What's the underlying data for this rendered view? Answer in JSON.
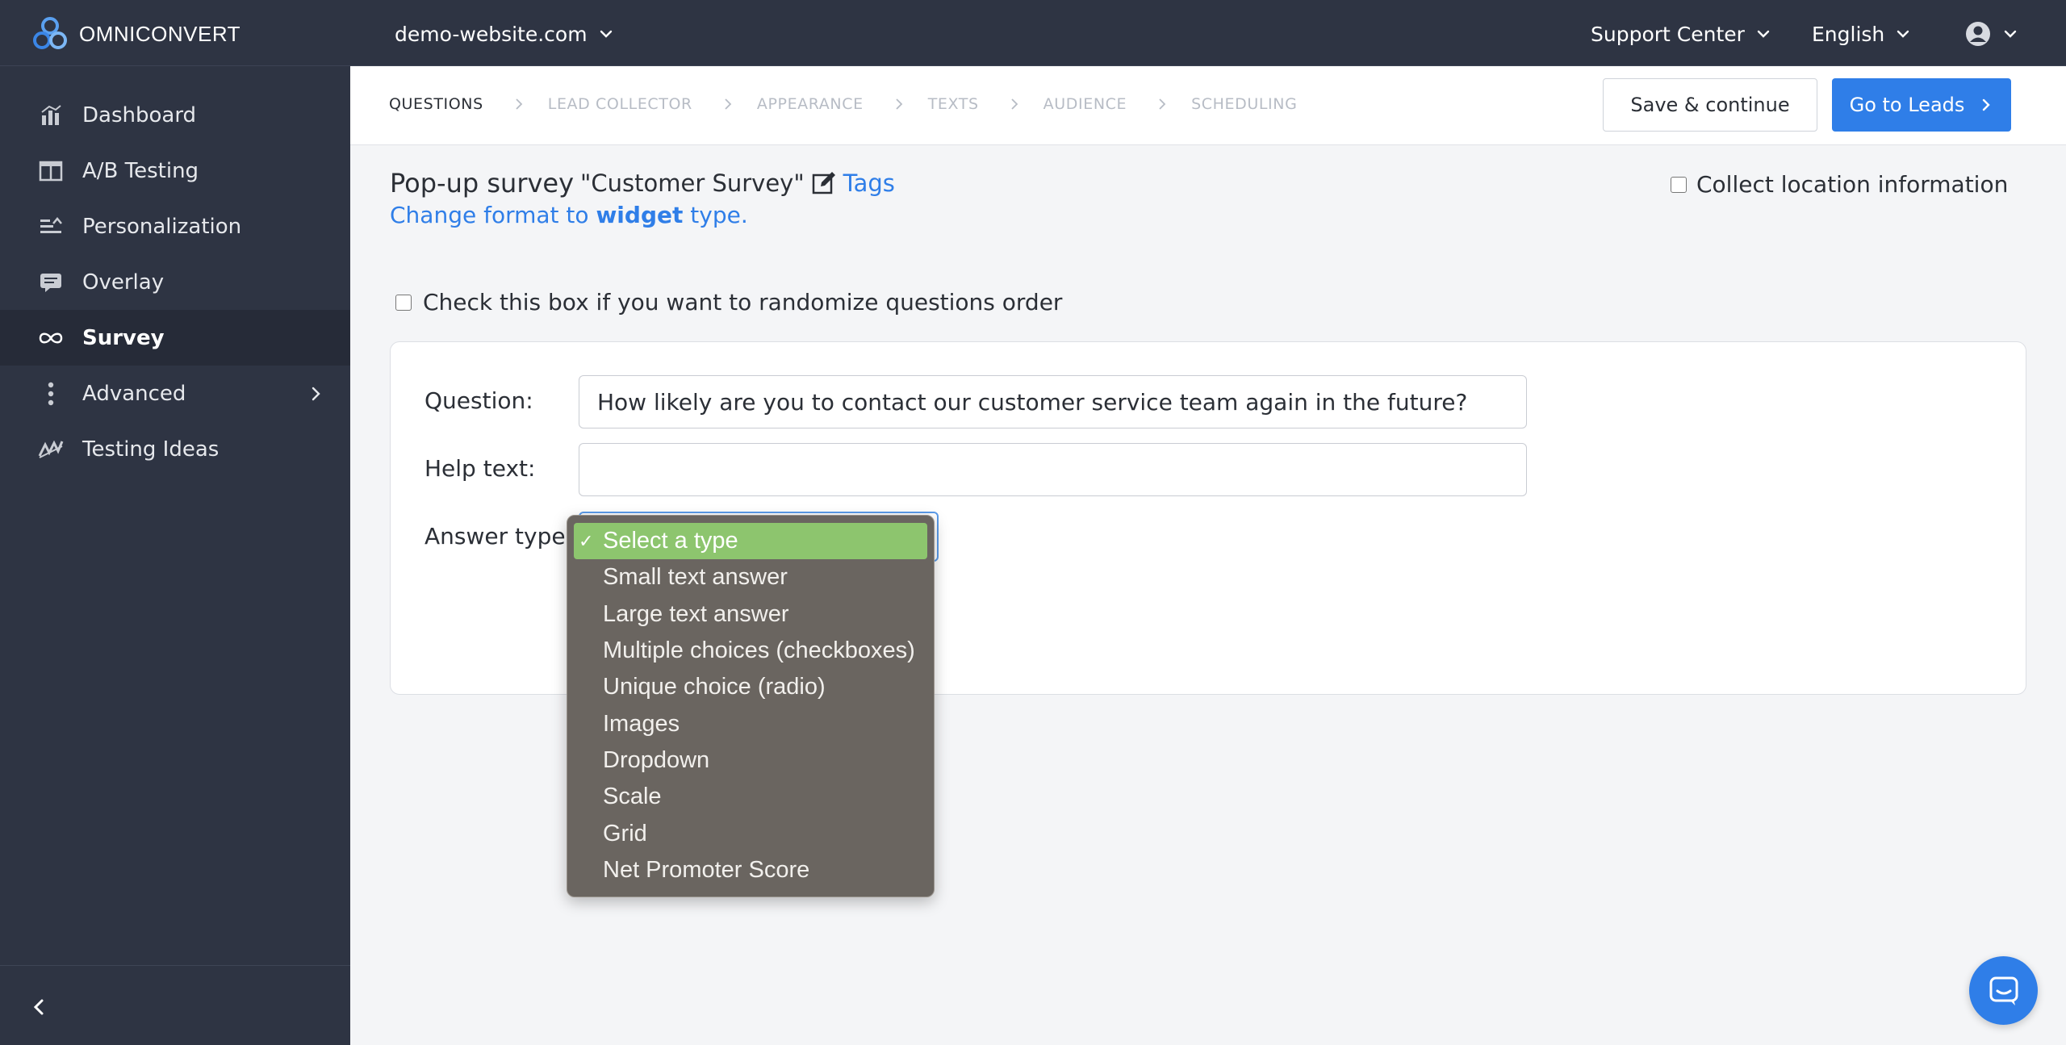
{
  "brand": {
    "name": "OMNICONVERT"
  },
  "topbar": {
    "website": "demo-website.com",
    "support": "Support Center",
    "language": "English"
  },
  "sidebar": {
    "items": [
      {
        "label": "Dashboard",
        "icon": "bar-chart-icon"
      },
      {
        "label": "A/B Testing",
        "icon": "split-window-icon"
      },
      {
        "label": "Personalization",
        "icon": "personalization-icon"
      },
      {
        "label": "Overlay",
        "icon": "overlay-icon"
      },
      {
        "label": "Survey",
        "icon": "infinity-icon",
        "active": true
      },
      {
        "label": "Advanced",
        "icon": "dots-vertical-icon"
      },
      {
        "label": "Testing Ideas",
        "icon": "ideas-icon"
      }
    ]
  },
  "wizard": {
    "steps": [
      "QUESTIONS",
      "LEAD COLLECTOR",
      "APPEARANCE",
      "TEXTS",
      "AUDIENCE",
      "SCHEDULING"
    ],
    "save_label": "Save & continue",
    "leads_label": "Go to Leads"
  },
  "survey": {
    "prefix": "Pop-up survey",
    "name": "\"Customer Survey\"",
    "tags": "Tags",
    "format_prefix": "Change format to",
    "format_type": "widget",
    "format_suffix": "type.",
    "collect_location": "Collect location information",
    "randomize": "Check this box if you want to randomize questions order"
  },
  "form": {
    "question_label": "Question:",
    "question_value": "How likely are you to contact our customer service team again in the future?",
    "help_label": "Help text:",
    "help_value": "",
    "answer_label": "Answer type:"
  },
  "answer_types": {
    "selected": "Select a type",
    "options": [
      "Select a type",
      "Small text answer",
      "Large text answer",
      "Multiple choices (checkboxes)",
      "Unique choice (radio)",
      "Images",
      "Dropdown",
      "Scale",
      "Grid",
      "Net Promoter Score"
    ]
  },
  "colors": {
    "sidebar_bg": "#2e3443",
    "accent": "#2f7ee8",
    "selected_option": "#8dc56e"
  }
}
